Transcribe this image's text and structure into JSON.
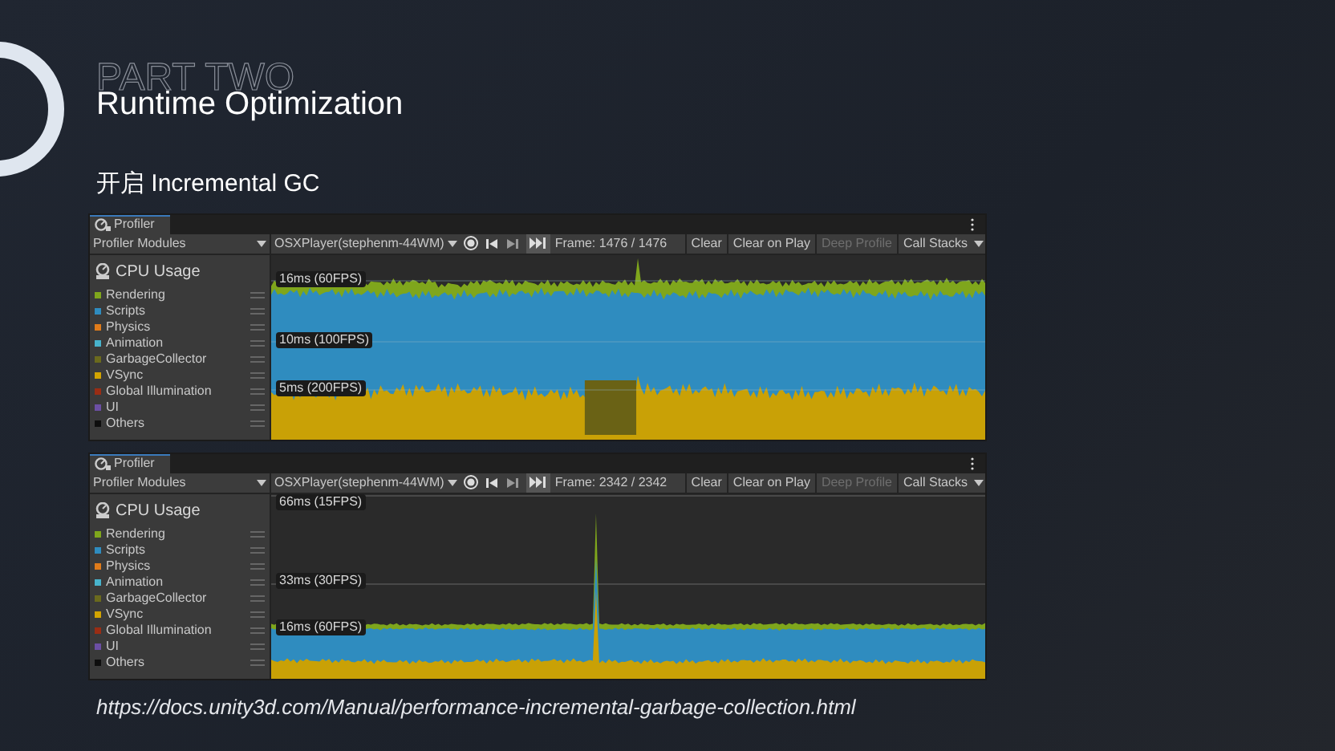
{
  "slide": {
    "part_label": "PART TWO",
    "title": "Runtime Optimization",
    "subtitle": "开启 Incremental GC"
  },
  "profilers": [
    {
      "tab": "Profiler",
      "modules_label": "Profiler Modules",
      "player": "OSXPlayer(stephenm-44WM)",
      "frame": "Frame: 1476 / 1476",
      "buttons": [
        {
          "label": "Clear",
          "disabled": false
        },
        {
          "label": "Clear on Play",
          "disabled": false
        },
        {
          "label": "Deep Profile",
          "disabled": true
        },
        {
          "label": "Call Stacks",
          "disabled": false
        }
      ],
      "module": "CPU Usage",
      "legend": [
        {
          "label": "Rendering",
          "color": "#7fa61c"
        },
        {
          "label": "Scripts",
          "color": "#2f8cbf"
        },
        {
          "label": "Physics",
          "color": "#e07b1a"
        },
        {
          "label": "Animation",
          "color": "#48b3cc"
        },
        {
          "label": "GarbageCollector",
          "color": "#6b6a1d"
        },
        {
          "label": "VSync",
          "color": "#d2a300"
        },
        {
          "label": "Global Illumination",
          "color": "#9a2d14"
        },
        {
          "label": "UI",
          "color": "#6c4fa3"
        },
        {
          "label": "Others",
          "color": "#0e0e0e"
        }
      ],
      "graph_labels": [
        "16ms (60FPS)",
        "10ms (100FPS)",
        "5ms (200FPS)"
      ]
    },
    {
      "tab": "Profiler",
      "modules_label": "Profiler Modules",
      "player": "OSXPlayer(stephenm-44WM)",
      "frame": "Frame: 2342 / 2342",
      "buttons": [
        {
          "label": "Clear",
          "disabled": false
        },
        {
          "label": "Clear on Play",
          "disabled": false
        },
        {
          "label": "Deep Profile",
          "disabled": true
        },
        {
          "label": "Call Stacks",
          "disabled": false
        }
      ],
      "module": "CPU Usage",
      "legend": [
        {
          "label": "Rendering",
          "color": "#7fa61c"
        },
        {
          "label": "Scripts",
          "color": "#2f8cbf"
        },
        {
          "label": "Physics",
          "color": "#e07b1a"
        },
        {
          "label": "Animation",
          "color": "#48b3cc"
        },
        {
          "label": "GarbageCollector",
          "color": "#6b6a1d"
        },
        {
          "label": "VSync",
          "color": "#d2a300"
        },
        {
          "label": "Global Illumination",
          "color": "#9a2d14"
        },
        {
          "label": "UI",
          "color": "#6c4fa3"
        },
        {
          "label": "Others",
          "color": "#0e0e0e"
        }
      ],
      "graph_labels": [
        "66ms (15FPS)",
        "33ms (30FPS)",
        "16ms (60FPS)"
      ]
    }
  ],
  "link": "https://docs.unity3d.com/Manual/performance-incremental-garbage-collection.html"
}
